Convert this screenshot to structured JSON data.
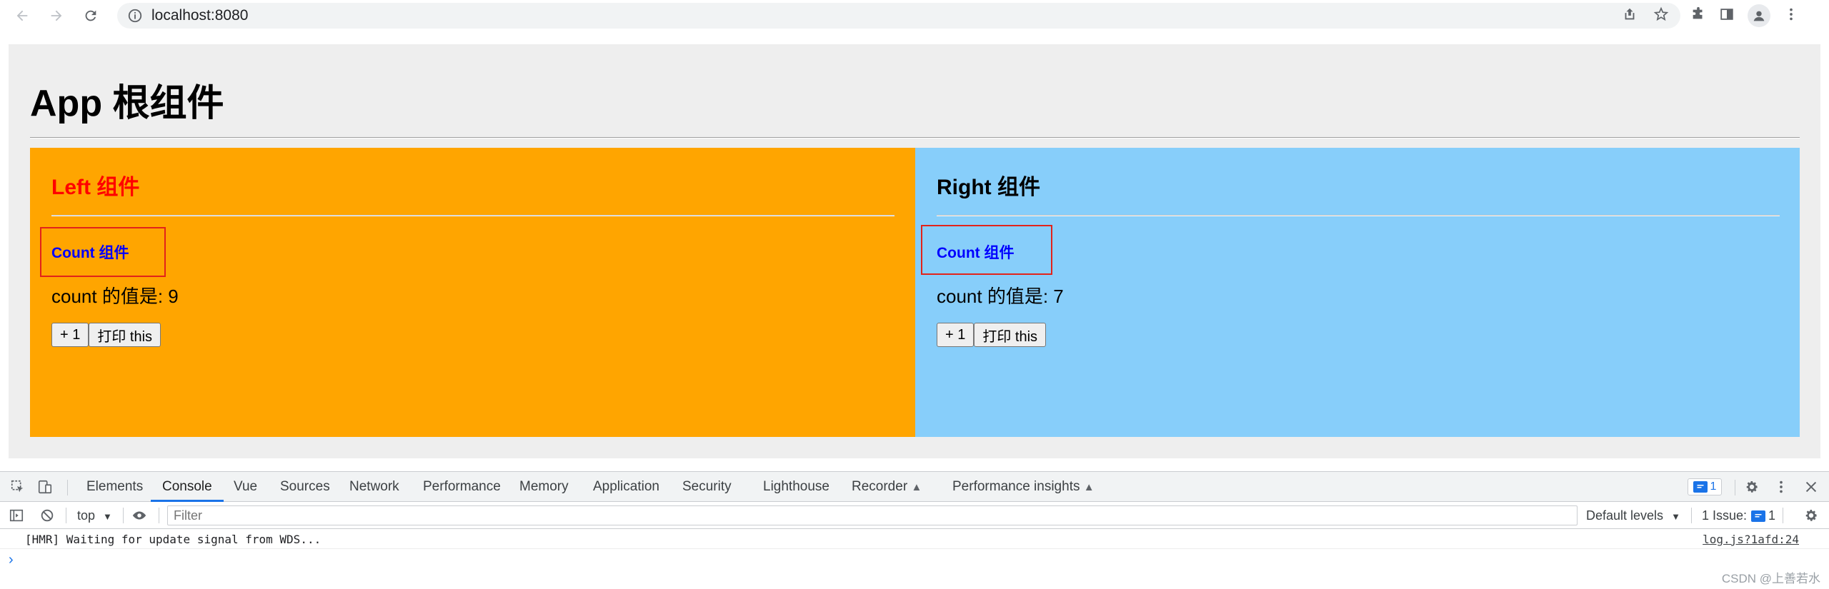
{
  "browser": {
    "url": "localhost:8080"
  },
  "app": {
    "title": "App 根组件",
    "left": {
      "title": "Left 组件",
      "title_color": "#ff0000",
      "bg": "#ffa500",
      "count_title": "Count 组件",
      "count_text": "count 的值是: 9",
      "btn_inc": "+ 1",
      "btn_print": "打印 this"
    },
    "right": {
      "title": "Right 组件",
      "title_color": "#000000",
      "bg": "#87cefa",
      "count_title": "Count 组件",
      "count_text": "count 的值是: 7",
      "btn_inc": "+ 1",
      "btn_print": "打印 this"
    }
  },
  "devtools": {
    "tabs": [
      "Elements",
      "Console",
      "Vue",
      "Sources",
      "Network",
      "Performance",
      "Memory",
      "Application",
      "Security",
      "Lighthouse",
      "Recorder",
      "Performance insights"
    ],
    "active_tab": "Console",
    "message_count": "1",
    "context": "top",
    "filter_placeholder": "Filter",
    "levels": "Default levels",
    "issues_label": "1 Issue:",
    "issues_count": "1",
    "console_message": "[HMR] Waiting for update signal from WDS...",
    "console_source": "log.js?1afd:24",
    "prompt": "›",
    "accent": "#1a73e8"
  },
  "watermark": "CSDN @上善若水"
}
